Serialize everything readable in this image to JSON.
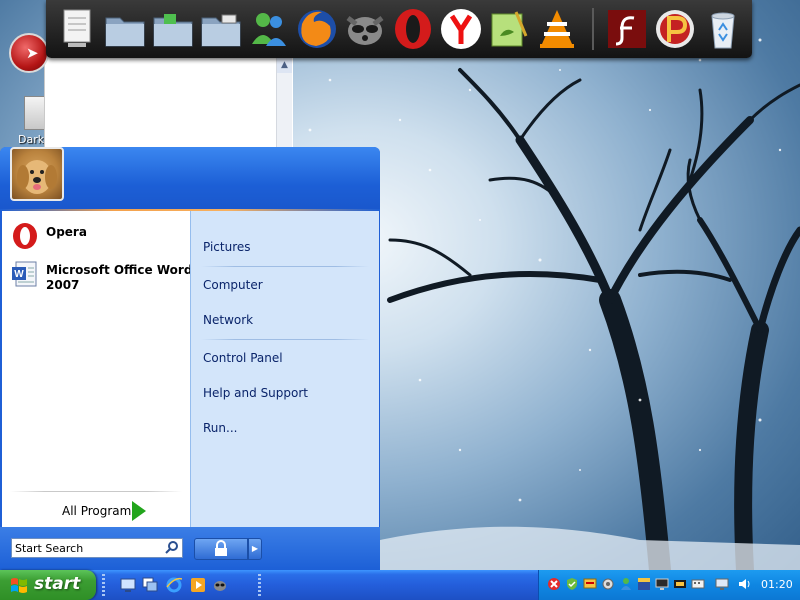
{
  "desktop": {
    "icon_label": "Dark"
  },
  "dock": {
    "items": [
      {
        "name": "notepad-icon"
      },
      {
        "name": "folder-icon"
      },
      {
        "name": "folder-icon"
      },
      {
        "name": "folder-icon"
      },
      {
        "name": "messenger-icon"
      },
      {
        "name": "firefox-icon"
      },
      {
        "name": "raccoon-icon"
      },
      {
        "name": "opera-icon"
      },
      {
        "name": "yandex-icon"
      },
      {
        "name": "notepad-plus-icon"
      },
      {
        "name": "vlc-icon"
      },
      {
        "name": "flash-icon"
      },
      {
        "name": "p-logo-icon"
      },
      {
        "name": "recycle-bin-icon"
      }
    ]
  },
  "start_menu": {
    "pinned": [
      {
        "label": "Opera",
        "icon": "opera-icon"
      },
      {
        "label": "Microsoft Office Word 2007",
        "icon": "word-icon"
      }
    ],
    "all_programs_label": "All Programs",
    "right_items": [
      {
        "label": "Pictures"
      },
      {
        "label": "Computer"
      },
      {
        "label": "Network"
      },
      {
        "label": "Control Panel"
      },
      {
        "label": "Help and Support"
      },
      {
        "label": "Run..."
      }
    ],
    "search": {
      "value": "Start Search"
    }
  },
  "taskbar": {
    "start_label": "start",
    "quicklaunch": [
      {
        "name": "desktop-icon"
      },
      {
        "name": "window-switch-icon"
      },
      {
        "name": "ie-icon"
      },
      {
        "name": "media-player-icon"
      },
      {
        "name": "raccoon-icon"
      }
    ],
    "clock": "01:20"
  },
  "colors": {
    "start_menu_blue": "#1f5fd6",
    "start_button_green": "#3c9e33",
    "taskbar_blue": "#245edb",
    "tray_blue": "#0f86e2"
  }
}
